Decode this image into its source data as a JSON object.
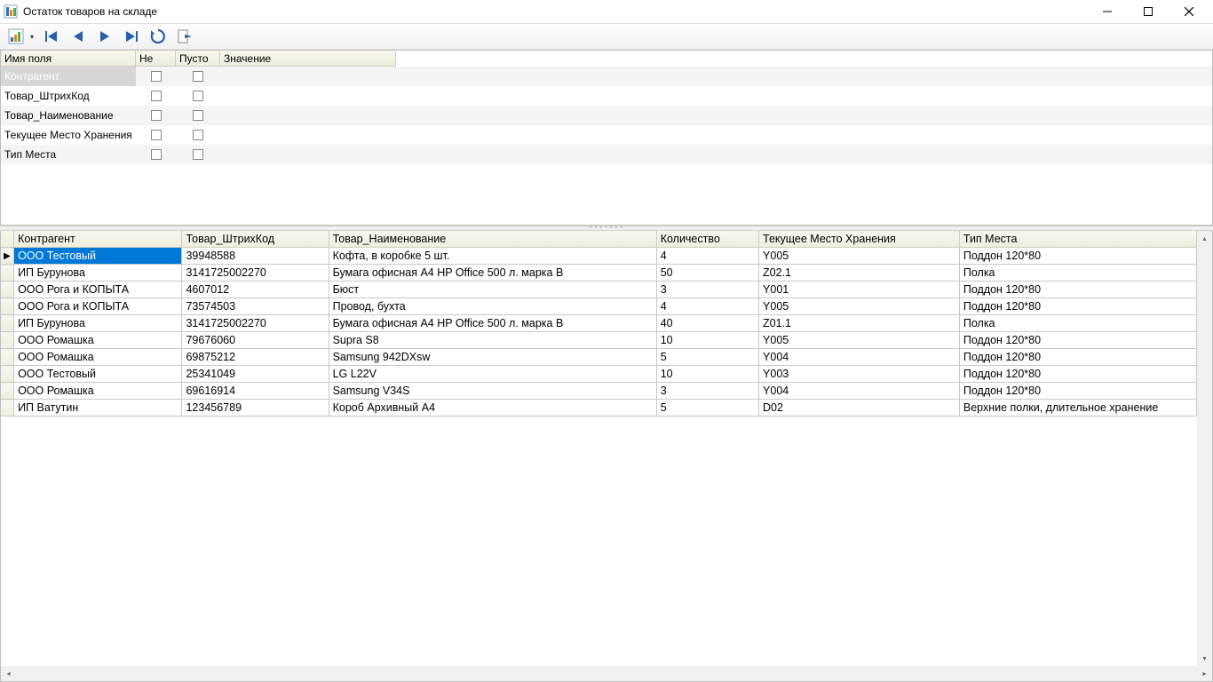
{
  "window": {
    "title": "Остаток товаров на складе"
  },
  "filter": {
    "headers": {
      "name": "Имя поля",
      "not": "Не",
      "empty": "Пусто",
      "value": "Значение"
    },
    "rows": [
      {
        "name": "Контрагент",
        "selected": true
      },
      {
        "name": "Товар_ШтрихКод",
        "selected": false
      },
      {
        "name": "Товар_Наименование",
        "selected": false
      },
      {
        "name": "Текущее Место Хранения",
        "selected": false
      },
      {
        "name": "Тип Места",
        "selected": false
      }
    ]
  },
  "grid": {
    "columns": [
      "Контрагент",
      "Товар_ШтрихКод",
      "Товар_Наименование",
      "Количество",
      "Текущее Место Хранения",
      "Тип Места"
    ],
    "rows": [
      {
        "selected": true,
        "cells": [
          "ООО Тестовый",
          "39948588",
          "Кофта, в коробке 5 шт.",
          "4",
          "Y005",
          "Поддон 120*80"
        ]
      },
      {
        "selected": false,
        "cells": [
          "ИП Бурунова",
          "3141725002270",
          "Бумага офисная A4 HP Office 500 л. марка B",
          "50",
          "Z02.1",
          "Полка"
        ]
      },
      {
        "selected": false,
        "cells": [
          "ООО Рога и КОПЫТА",
          "4607012",
          "Бюст",
          "3",
          "Y001",
          "Поддон 120*80"
        ]
      },
      {
        "selected": false,
        "cells": [
          "ООО Рога и КОПЫТА",
          "73574503",
          "Провод, бухта",
          "4",
          "Y005",
          "Поддон 120*80"
        ]
      },
      {
        "selected": false,
        "cells": [
          "ИП Бурунова",
          "3141725002270",
          "Бумага офисная A4 HP Office 500 л. марка B",
          "40",
          "Z01.1",
          "Полка"
        ]
      },
      {
        "selected": false,
        "cells": [
          "ООО Ромашка",
          "79676060",
          "Supra S8",
          "10",
          "Y005",
          "Поддон 120*80"
        ]
      },
      {
        "selected": false,
        "cells": [
          "ООО Ромашка",
          "69875212",
          "Samsung 942DXsw",
          "5",
          "Y004",
          "Поддон 120*80"
        ]
      },
      {
        "selected": false,
        "cells": [
          "ООО Тестовый",
          "25341049",
          "LG L22V",
          "10",
          "Y003",
          "Поддон 120*80"
        ]
      },
      {
        "selected": false,
        "cells": [
          "ООО Ромашка",
          "69616914",
          "Samsung V34S",
          "3",
          "Y004",
          "Поддон 120*80"
        ]
      },
      {
        "selected": false,
        "cells": [
          "ИП Ватутин",
          "123456789",
          "Короб Архивный А4",
          "5",
          "D02",
          "Верхние полки, длительное хранение"
        ]
      }
    ]
  }
}
